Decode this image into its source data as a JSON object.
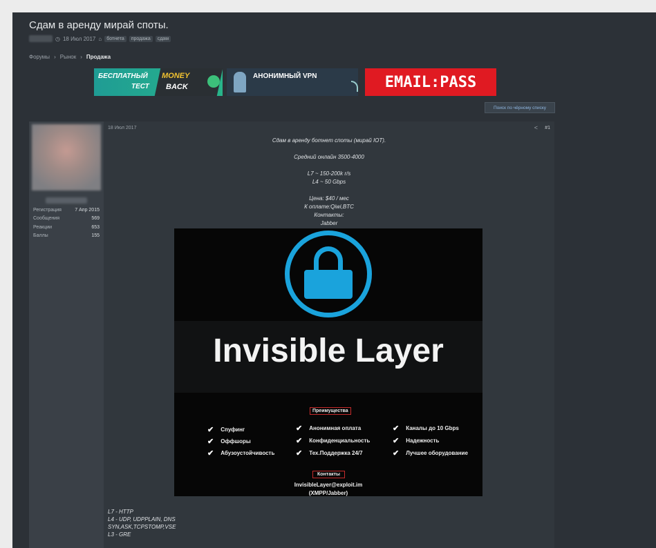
{
  "thread": {
    "title": "Сдам в аренду мирай споты.",
    "date": "18 Июл 2017",
    "tags": [
      "ботнета",
      "продажа",
      "сдам"
    ]
  },
  "breadcrumb": {
    "items": [
      "Форумы",
      "Рынок"
    ],
    "current": "Продажа",
    "separator": "›"
  },
  "banners": {
    "b1_line1": "БЕСПЛАТНЫЙ",
    "b1_line2": "ТЕСТ",
    "b1_money": "MONEY",
    "b1_back": "BACK",
    "b2_text": "АНОНИМНЫЙ VPN",
    "b3_text": "EMAIL:PASS"
  },
  "blacklist_button": "Поиск по чёрному списку",
  "user": {
    "stats": [
      {
        "label": "Регистрация",
        "value": "7 Апр 2015"
      },
      {
        "label": "Сообщения",
        "value": "569"
      },
      {
        "label": "Реакции",
        "value": "653"
      },
      {
        "label": "Баллы",
        "value": "155"
      }
    ]
  },
  "post": {
    "date": "18 Июл 2017",
    "number": "#1",
    "lines": [
      "Сдам в аренду ботнет споты (мирай IOT).",
      "",
      "Средний онлайн 3500-4000",
      "",
      "L7 ~ 150-200k r/s",
      "L4 ~ 50 Gbps",
      "",
      "Цена: $40 / мес",
      "К оплате:Qiwi,BTC",
      "Контакты:",
      "Jabber"
    ],
    "bottom_lines": [
      "L7 - HTTP",
      "L4 - UDP, UDPPLAIN, DNS",
      "SYN,ASK,TCPSTOMP,VSE",
      "L3 - GRE"
    ]
  },
  "ad_image": {
    "brand": "Invisible Layer",
    "advantages_label": "Преимущества",
    "features": [
      "Спуфинг",
      "Анонимная оплата",
      "Каналы до 10  Gbps",
      "Оффшоры",
      "Конфиденциальность",
      "Надежность",
      "Абузоустойчивость",
      "Тех.Поддержка 24/7",
      "Лучшее оборудование"
    ],
    "contacts_label": "Контакты",
    "email": "InvisibleLayer@exploit.im",
    "xmpp": "(XMPP/Jabber)"
  },
  "colors": {
    "lock_blue": "#1aa3dc",
    "banner_red": "#e01a22",
    "page_bg": "#2c3137"
  },
  "icons": {
    "clock": "clock-icon",
    "tag": "tag-icon",
    "share": "share-icon",
    "check": "check-icon",
    "lock": "padlock-icon"
  }
}
